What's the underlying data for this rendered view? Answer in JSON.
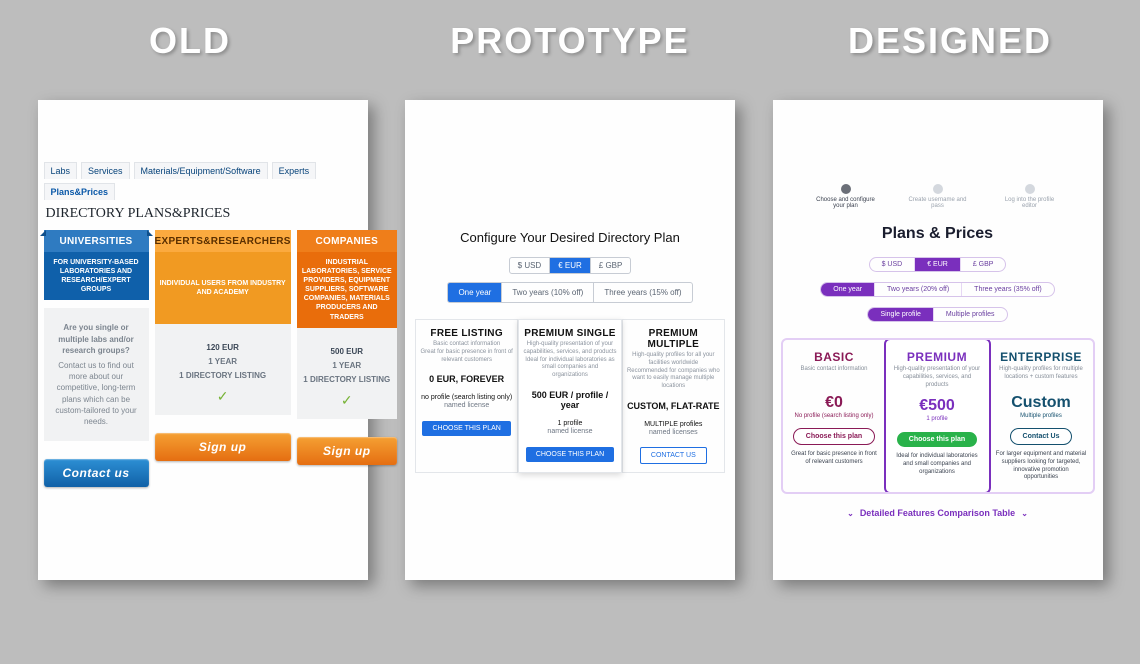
{
  "columns": {
    "old": "OLD",
    "prototype": "PROTOTYPE",
    "designed": "DESIGNED"
  },
  "old": {
    "tabs": [
      "Labs",
      "Services",
      "Materials/Equipment/Software",
      "Experts",
      "Plans&Prices"
    ],
    "active_tab": "Plans&Prices",
    "heading": "DIRECTORY PLANS&PRICES",
    "cols": {
      "universities": {
        "title": "UNIVERSITIES",
        "sub": "FOR UNIVERSITY-BASED LABORATORIES AND RESEARCH/EXPERT GROUPS",
        "ask_q": "Are you single or multiple labs and/or research groups?",
        "ask_body": "Contact us to find out more about our competitive, long-term plans which can be custom-tailored to your needs.",
        "cta": "Contact us"
      },
      "experts": {
        "title": "EXPERTS&RESEARCHERS",
        "sub": "INDIVIDUAL USERS FROM INDUSTRY AND ACADEMY",
        "price": "120 EUR",
        "term": "1 YEAR",
        "feat": "1 DIRECTORY LISTING",
        "cta": "Sign up"
      },
      "companies": {
        "title": "COMPANIES",
        "sub": "INDUSTRIAL LABORATORIES, SERVICE PROVIDERS, EQUIPMENT SUPPLIERS, SOFTWARE COMPANIES, MATERIALS PRODUCERS AND TRADERS",
        "price": "500 EUR",
        "term": "1 YEAR",
        "feat": "1 DIRECTORY LISTING",
        "cta": "Sign up"
      }
    }
  },
  "prototype": {
    "title": "Configure Your Desired Directory Plan",
    "currency": {
      "opts": [
        "$ USD",
        "€ EUR",
        "£ GBP"
      ],
      "sel": "€ EUR"
    },
    "duration": {
      "opts": [
        "One year",
        "Two years (10% off)",
        "Three years (15% off)"
      ],
      "sel": "One year"
    },
    "cards": [
      {
        "title": "FREE LISTING",
        "sub": "Basic contact information",
        "sub2": "Great for basic presence in front of relevant customers",
        "price": "0 EUR, FOREVER",
        "p1": "no profile (search listing only)",
        "p2": "named license",
        "btn": "CHOOSE THIS PLAN",
        "style": "fill"
      },
      {
        "title": "PREMIUM SINGLE",
        "sub": "High-quality presentation of your capabilities, services, and products",
        "sub2": "Ideal for individual laboratories as small companies and organizations",
        "price": "500 EUR / profile / year",
        "p1": "1 profile",
        "p2": "named license",
        "btn": "CHOOSE THIS PLAN",
        "style": "fill"
      },
      {
        "title": "PREMIUM MULTIPLE",
        "sub": "High-quality profiles for all your facilities worldwide",
        "sub2": "Recommended for companies who want to easily manage multiple locations",
        "price": "CUSTOM, FLAT-RATE",
        "p1": "MULTIPLE profiles",
        "p2": "named licenses",
        "btn": "CONTACT US",
        "style": "ghost"
      }
    ]
  },
  "designed": {
    "steps": [
      {
        "n": "1",
        "label": "Choose and configure your plan",
        "active": true
      },
      {
        "n": "2",
        "label": "Create username and pass",
        "active": false
      },
      {
        "n": "3",
        "label": "Log into the profile editor",
        "active": false
      }
    ],
    "title": "Plans & Prices",
    "currency": {
      "opts": [
        "$ USD",
        "€ EUR",
        "£ GBP"
      ],
      "sel": "€ EUR"
    },
    "duration": {
      "opts": [
        "One year",
        "Two years (20% off)",
        "Three years (35% off)"
      ],
      "sel": "One year"
    },
    "mode": {
      "opts": [
        "Single profile",
        "Multiple profiles"
      ],
      "sel": "Single profile"
    },
    "cards": [
      {
        "title": "BASIC",
        "sub": "Basic contact information",
        "price": "€0",
        "prnote": "No profile (search listing only)",
        "btn": "Choose this plan",
        "foot": "Great for basic presence in front of relevant customers"
      },
      {
        "title": "PREMIUM",
        "sub": "High-quality presentation of your capabilities, services, and products",
        "price": "€500",
        "prnote": "1 profile",
        "btn": "Choose this plan",
        "foot": "Ideal for individual laboratories and small companies and organizations"
      },
      {
        "title": "ENTERPRISE",
        "sub": "High-quality profiles for multiple locations + custom features",
        "price": "Custom",
        "prnote": "Multiple profiles",
        "btn": "Contact Us",
        "foot": "For larger equipment and material suppliers looking for targeted, innovative promotion opportunities"
      }
    ],
    "toggle": "Detailed Features Comparison Table"
  }
}
